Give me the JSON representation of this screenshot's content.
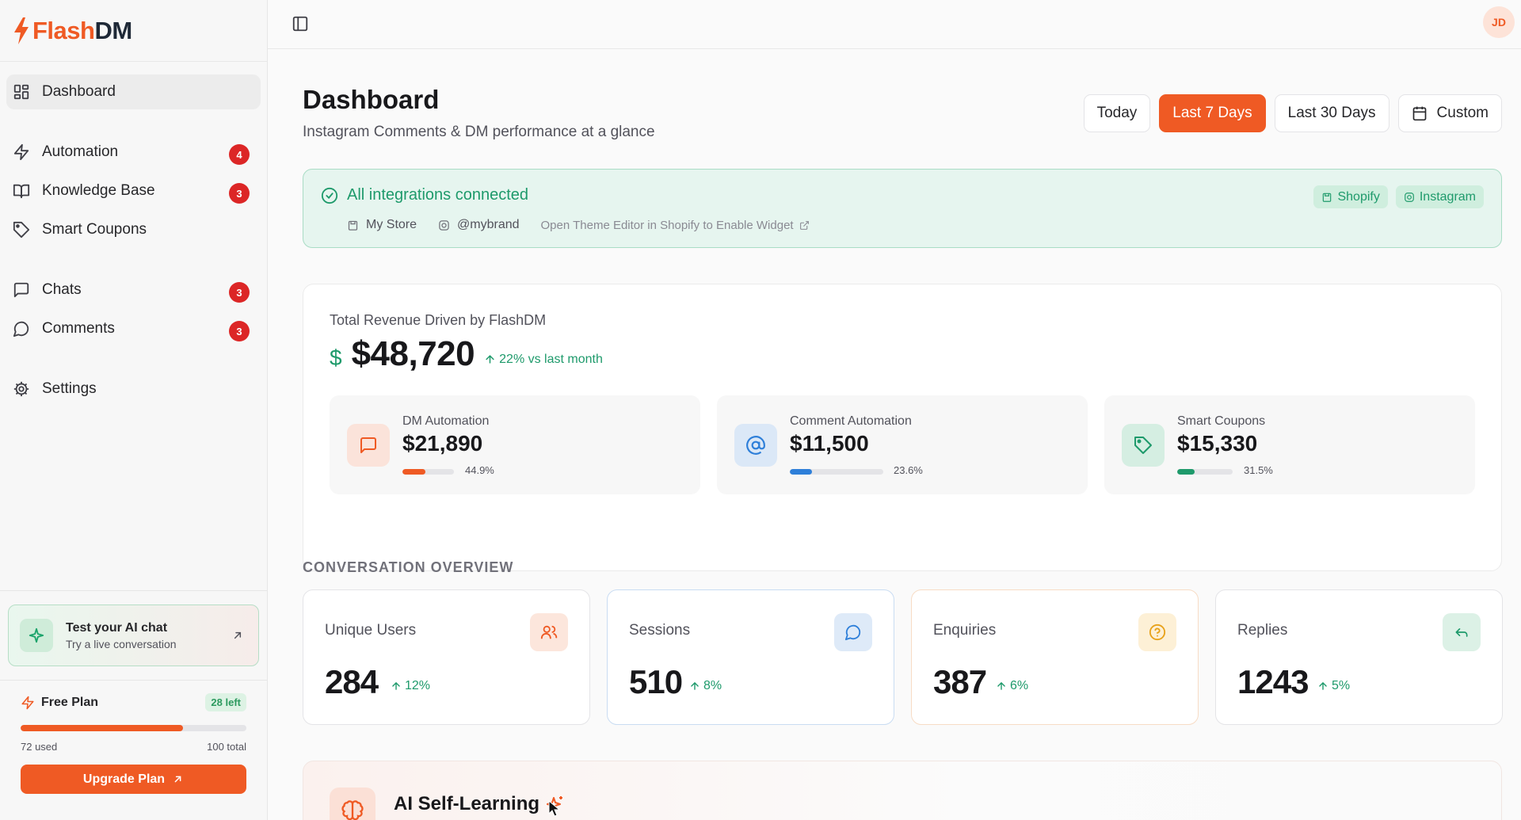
{
  "app": {
    "logo_part1": "Flash",
    "logo_part2": "DM",
    "brand_color": "#ef5a24"
  },
  "sidebar": {
    "items": [
      {
        "label": "Dashboard",
        "icon": "layout-grid-icon",
        "active": true
      },
      {
        "label": "Automation",
        "icon": "zap-icon",
        "badge": "4"
      },
      {
        "label": "Knowledge Base",
        "icon": "book-open-icon",
        "badge": "3"
      },
      {
        "label": "Smart Coupons",
        "icon": "tag-icon"
      },
      {
        "label": "Chats",
        "icon": "message-square-icon",
        "badge": "3"
      },
      {
        "label": "Comments",
        "icon": "message-circle-icon",
        "badge": "3"
      },
      {
        "label": "Settings",
        "icon": "gear-icon"
      }
    ],
    "test_card": {
      "title": "Test your AI chat",
      "subtitle": "Try a live conversation"
    },
    "plan": {
      "name": "Free Plan",
      "left": "28 left",
      "used": "72 used",
      "total": "100 total",
      "used_fraction": 0.72,
      "upgrade_label": "Upgrade Plan"
    }
  },
  "topbar": {
    "avatar_initials": "JD"
  },
  "header": {
    "title": "Dashboard",
    "subtitle": "Instagram Comments & DM performance at a glance",
    "ranges": [
      "Today",
      "Last 7 Days",
      "Last 30 Days",
      "Custom"
    ],
    "active_range": "Last 7 Days"
  },
  "integrations": {
    "status": "All integrations connected",
    "store": "My Store",
    "handle": "@mybrand",
    "hint": "Open Theme Editor in Shopify to Enable Widget",
    "tags": [
      "Shopify",
      "Instagram"
    ]
  },
  "revenue": {
    "label": "Total Revenue Driven by FlashDM",
    "currency_symbol": "$",
    "amount": "$48,720",
    "trend": "22% vs last month",
    "breakdown": [
      {
        "name": "DM Automation",
        "value": "$21,890",
        "pct": "44.9%",
        "fraction": 0.449,
        "color": "#ef5a24",
        "icon": "message-square-icon"
      },
      {
        "name": "Comment Automation",
        "value": "$11,500",
        "pct": "23.6%",
        "fraction": 0.236,
        "color": "#2e7fd9",
        "icon": "at-sign-icon"
      },
      {
        "name": "Smart Coupons",
        "value": "$15,330",
        "pct": "31.5%",
        "fraction": 0.315,
        "color": "#1e9a6b",
        "icon": "tag-icon"
      }
    ]
  },
  "overview": {
    "title": "CONVERSATION OVERVIEW",
    "stats": [
      {
        "label": "Unique Users",
        "value": "284",
        "trend": "12%",
        "icon": "users-icon",
        "color": "#ef5a24"
      },
      {
        "label": "Sessions",
        "value": "510",
        "trend": "8%",
        "icon": "message-circle-icon",
        "color": "#2e7fd9"
      },
      {
        "label": "Enquiries",
        "value": "387",
        "trend": "6%",
        "icon": "help-circle-icon",
        "color": "#e8a21a"
      },
      {
        "label": "Replies",
        "value": "1243",
        "trend": "5%",
        "icon": "reply-icon",
        "color": "#1e9a6b"
      }
    ]
  },
  "ai": {
    "title": "AI Self-Learning"
  }
}
